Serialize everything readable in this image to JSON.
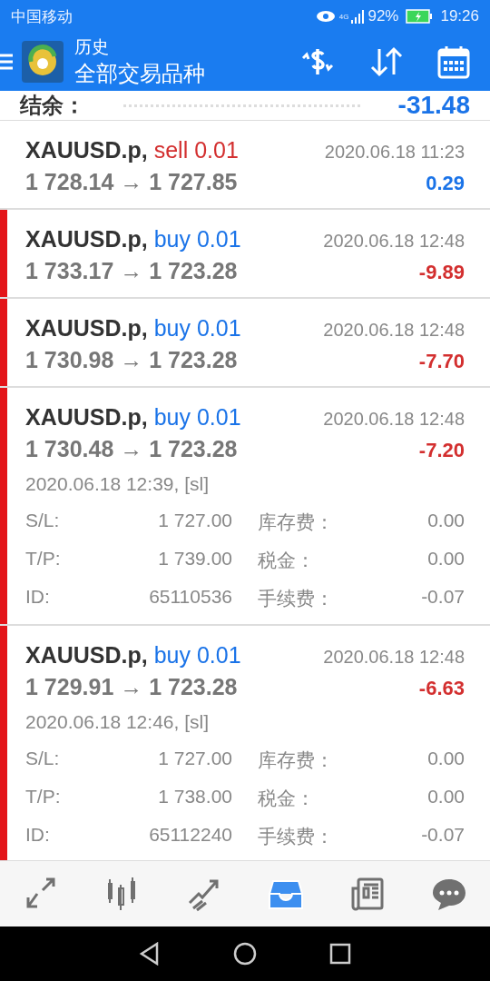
{
  "status_bar": {
    "carrier": "中国移动",
    "network": "4G",
    "battery": "92%",
    "time": "19:26"
  },
  "header": {
    "title": "历史",
    "subtitle": "全部交易品种"
  },
  "balance": {
    "label": "结余：",
    "value": "-31.48"
  },
  "trades": [
    {
      "symbol": "XAUUSD.p,",
      "kind": "sell",
      "marked": false,
      "action": "sell 0.01",
      "time": "2020.06.18 11:23",
      "prices": "1 728.14 → 1 727.85",
      "profit": "0.29",
      "color": "#1a73e8",
      "expanded": false
    },
    {
      "symbol": "XAUUSD.p,",
      "kind": "buy",
      "marked": true,
      "action": "buy 0.01",
      "time": "2020.06.18 12:48",
      "prices": "1 733.17 → 1 723.28",
      "profit": "-9.89",
      "color": "#d32f2f",
      "expanded": false
    },
    {
      "symbol": "XAUUSD.p,",
      "kind": "buy",
      "marked": true,
      "action": "buy 0.01",
      "time": "2020.06.18 12:48",
      "prices": "1 730.98 → 1 723.28",
      "profit": "-7.70",
      "color": "#d32f2f",
      "expanded": false
    },
    {
      "symbol": "XAUUSD.p,",
      "kind": "buy",
      "marked": true,
      "action": "buy 0.01",
      "time": "2020.06.18 12:48",
      "prices": "1 730.48 → 1 723.28",
      "profit": "-7.20",
      "color": "#d32f2f",
      "expanded": true,
      "open_time": "2020.06.18 12:39, [sl]",
      "details": [
        {
          "label": "S/L:",
          "value": "1 727.00",
          "label2": "库存费：",
          "value2": "0.00"
        },
        {
          "label": "T/P:",
          "value": "1 739.00",
          "label2": "税金：",
          "value2": "0.00"
        },
        {
          "label": "ID:",
          "value": "65110536",
          "label2": "手续费：",
          "value2": "-0.07"
        }
      ]
    },
    {
      "symbol": "XAUUSD.p,",
      "kind": "buy",
      "marked": true,
      "action": "buy 0.01",
      "time": "2020.06.18 12:48",
      "prices": "1 729.91 → 1 723.28",
      "profit": "-6.63",
      "color": "#d32f2f",
      "expanded": true,
      "open_time": "2020.06.18 12:46, [sl]",
      "details": [
        {
          "label": "S/L:",
          "value": "1 727.00",
          "label2": "库存费：",
          "value2": "0.00"
        },
        {
          "label": "T/P:",
          "value": "1 738.00",
          "label2": "税金：",
          "value2": "0.00"
        },
        {
          "label": "ID:",
          "value": "65112240",
          "label2": "手续费：",
          "value2": "-0.07"
        }
      ]
    }
  ],
  "bottom_nav": [
    {
      "kind": "trade",
      "selected": false
    },
    {
      "kind": "quotes",
      "selected": false
    },
    {
      "kind": "chart",
      "selected": false
    },
    {
      "kind": "history",
      "selected": true
    },
    {
      "kind": "news",
      "selected": false
    },
    {
      "kind": "chat",
      "selected": false
    }
  ]
}
